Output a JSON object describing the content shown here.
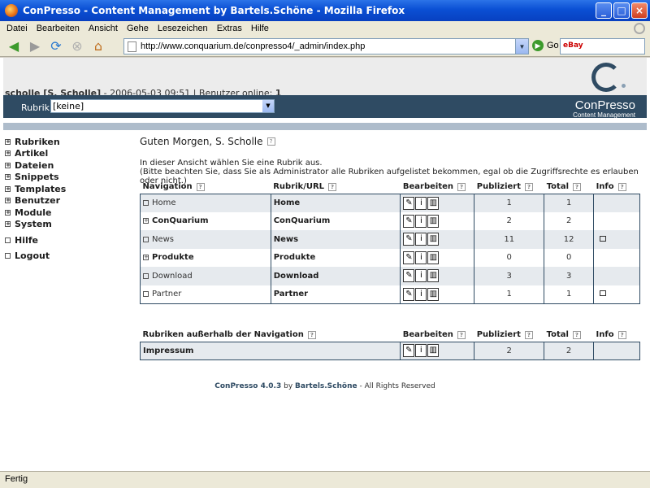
{
  "window": {
    "title": "ConPresso - Content Management by Bartels.Schöne - Mozilla Firefox"
  },
  "menu": [
    "Datei",
    "Bearbeiten",
    "Ansicht",
    "Gehe",
    "Lesezeichen",
    "Extras",
    "Hilfe"
  ],
  "nav": {
    "url": "http://www.conquarium.de/conpresso4/_admin/index.php",
    "go_label": "Go",
    "search_engine": "eBay"
  },
  "header": {
    "user": "scholle [S. Scholle]",
    "datetime": "- 2006-05-03 09:51 | Benutzer online:",
    "online_count": "1",
    "rubrik_label": "Rubrik:",
    "rubrik_value": "[keine]",
    "logo_name": "ConPresso",
    "logo_sub": "Content Management"
  },
  "sidebar": [
    {
      "label": "Rubriken",
      "expand": "+"
    },
    {
      "label": "Artikel",
      "expand": "+"
    },
    {
      "label": "Dateien",
      "expand": "+"
    },
    {
      "label": "Snippets",
      "expand": "+"
    },
    {
      "label": "Templates",
      "expand": "+"
    },
    {
      "label": "Benutzer",
      "expand": "+"
    },
    {
      "label": "Module",
      "expand": "+"
    },
    {
      "label": "System",
      "expand": "+"
    },
    {
      "label": "Hilfe",
      "expand": ""
    },
    {
      "label": "Logout",
      "expand": ""
    }
  ],
  "main": {
    "greeting": "Guten Morgen, S. Scholle",
    "intro_line1": "In dieser Ansicht wählen Sie eine Rubrik aus.",
    "intro_line2": "(Bitte beachten Sie, dass Sie als Administrator alle Rubriken aufgelistet bekommen, egal ob die Zugriffsrechte es erlauben oder nicht.)"
  },
  "table1": {
    "headers": [
      "Navigation",
      "Rubrik/URL",
      "Bearbeiten",
      "Publiziert",
      "Total",
      "Info"
    ],
    "rows": [
      {
        "nav": "Home",
        "expand": "",
        "bold": false,
        "rubrik": "Home",
        "pub": "1",
        "total": "1",
        "locked": false
      },
      {
        "nav": "ConQuarium",
        "expand": "+",
        "bold": true,
        "rubrik": "ConQuarium",
        "pub": "2",
        "total": "2",
        "locked": false
      },
      {
        "nav": "News",
        "expand": "",
        "bold": false,
        "rubrik": "News",
        "pub": "11",
        "total": "12",
        "locked": true
      },
      {
        "nav": "Produkte",
        "expand": "+",
        "bold": true,
        "rubrik": "Produkte",
        "pub": "0",
        "total": "0",
        "locked": false
      },
      {
        "nav": "Download",
        "expand": "",
        "bold": false,
        "rubrik": "Download",
        "pub": "3",
        "total": "3",
        "locked": false
      },
      {
        "nav": "Partner",
        "expand": "",
        "bold": false,
        "rubrik": "Partner",
        "pub": "1",
        "total": "1",
        "locked": true
      }
    ]
  },
  "table2": {
    "headers": [
      "Rubriken außerhalb der Navigation",
      "Bearbeiten",
      "Publiziert",
      "Total",
      "Info"
    ],
    "rows": [
      {
        "name": "Impressum",
        "pub": "2",
        "total": "2"
      }
    ]
  },
  "footer": {
    "product": "ConPresso 4.0.3",
    "by": "by",
    "company": "Bartels.Schöne",
    "rights": "- All Rights Reserved"
  },
  "status": "Fertig"
}
